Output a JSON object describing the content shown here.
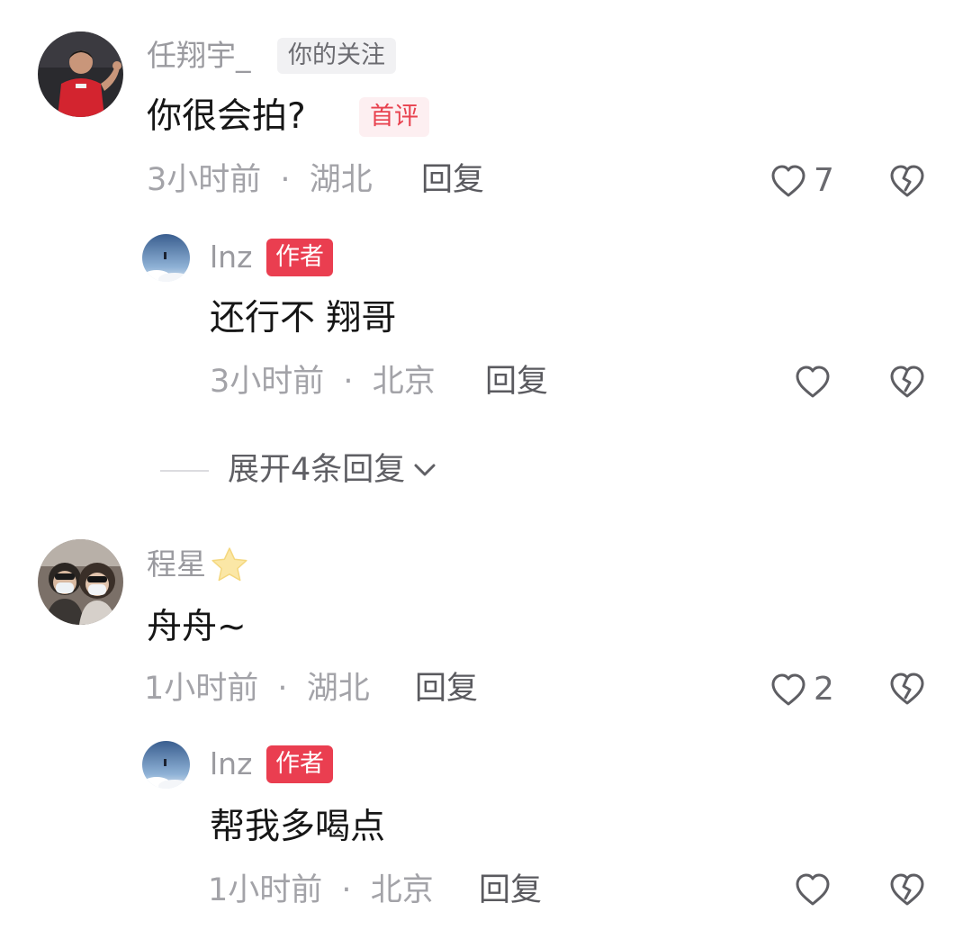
{
  "comments": [
    {
      "username": "任翔宇_",
      "follow_badge": "你的关注",
      "text": "你很会拍?",
      "first_badge": "首评",
      "time": "3小时前",
      "location": "湖北",
      "reply_label": "回复",
      "likes": "7",
      "reply": {
        "username": "lnz",
        "author_badge": "作者",
        "text": "还行不 翔哥",
        "time": "3小时前",
        "location": "北京",
        "reply_label": "回复"
      },
      "expand_label": "展开4条回复"
    },
    {
      "username": "程星",
      "text": "舟舟~",
      "time": "1小时前",
      "location": "湖北",
      "reply_label": "回复",
      "likes": "2",
      "reply": {
        "username": "lnz",
        "author_badge": "作者",
        "text": "帮我多喝点",
        "time": "1小时前",
        "location": "北京",
        "reply_label": "回复"
      }
    }
  ],
  "meta_separator": "·",
  "icons": {
    "like": "heart-outline-icon",
    "dislike": "broken-heart-icon",
    "star": "star-emoji-icon",
    "expand": "chevron-down-icon"
  },
  "colors": {
    "author_badge": "#ea3e50",
    "first_badge_text": "#e8424f",
    "meta_text": "#a3a3a8",
    "username_text": "#9a9a9f"
  }
}
